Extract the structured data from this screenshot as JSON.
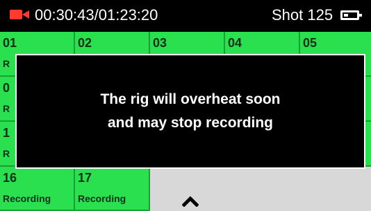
{
  "status": {
    "timecode": "00:30:43/01:23:20",
    "shot": "Shot 125",
    "icons": {
      "camera": "video-camera-icon",
      "battery": "battery-icon"
    },
    "colors": {
      "camera": "#ff3b30",
      "background": "#000000"
    }
  },
  "grid": {
    "colors": {
      "recording": "#2be04f",
      "border": "#1a9f34",
      "empty": "#d8d8d8"
    },
    "cells": [
      {
        "number": "01",
        "status": "R"
      },
      {
        "number": "02",
        "status": ""
      },
      {
        "number": "03",
        "status": ""
      },
      {
        "number": "04",
        "status": ""
      },
      {
        "number": "05",
        "status": ""
      },
      {
        "number": "0",
        "status": "R"
      },
      {
        "number": "1",
        "status": "R"
      },
      {
        "number": "16",
        "status": "Recording"
      },
      {
        "number": "17",
        "status": "Recording"
      }
    ],
    "nav_icon": "chevron-up-icon"
  },
  "alert": {
    "line1": "The rig will overheat soon",
    "line2": "and may stop recording"
  }
}
